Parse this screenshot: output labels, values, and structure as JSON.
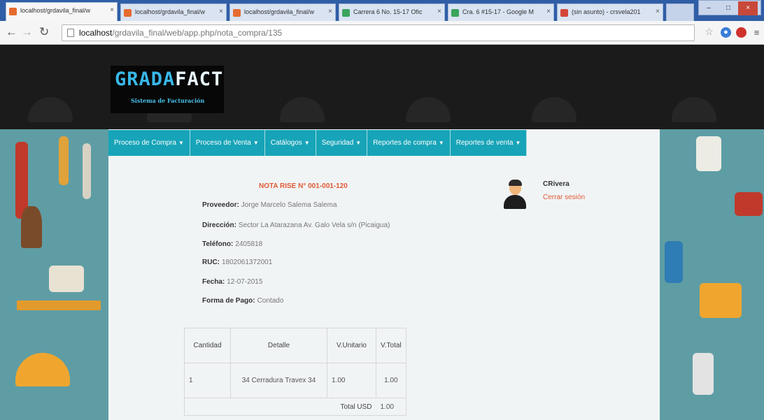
{
  "browser": {
    "tabs": [
      {
        "label": "localhost/grdavila_final/w"
      },
      {
        "label": "localhost/grdavila_final/w"
      },
      {
        "label": "localhost/grdavila_final/w"
      },
      {
        "label": "Carrera 6 No. 15-17 Ofic"
      },
      {
        "label": "Cra. 6 #15-17 - Google M"
      },
      {
        "label": "(sin asunto) - crsvela201"
      }
    ],
    "url_host": "localhost",
    "url_path": "/grdavila_final/web/app.php/nota_compra/135"
  },
  "logo": {
    "title_part1": "GRADA",
    "title_part2": "FACT",
    "subtitle": "Sistema de Facturación"
  },
  "menu": [
    {
      "label": "Proceso de Compra"
    },
    {
      "label": "Proceso de Venta"
    },
    {
      "label": "Catálogos"
    },
    {
      "label": "Seguridad"
    },
    {
      "label": "Reportes de compra"
    },
    {
      "label": "Reportes de venta"
    }
  ],
  "note": {
    "title": "NOTA RISE N° 001-001-120",
    "proveedor_label": "Proveedor:",
    "proveedor": "Jorge Marcelo Salema Salema",
    "direccion_label": "Dirección:",
    "direccion": "Sector La Atarazana Av. Galo Vela s/n (Picaigua)",
    "telefono_label": "Teléfono:",
    "telefono": "2405818",
    "ruc_label": "RUC:",
    "ruc": "1802061372001",
    "fecha_label": "Fecha:",
    "fecha": "12-07-2015",
    "pago_label": "Forma de Pago:",
    "pago": "Contado"
  },
  "user": {
    "name": "CRivera",
    "logout": "Cerrar sesión"
  },
  "table": {
    "headers": [
      "Cantidad",
      "Detalle",
      "V.Unitario",
      "V.Total"
    ],
    "rows": [
      {
        "cantidad": "1",
        "detalle": "34 Cerradura Travex 34",
        "unitario": "1.00",
        "total": "1.00"
      }
    ],
    "total_label": "Total USD",
    "total_value": "1.00"
  }
}
